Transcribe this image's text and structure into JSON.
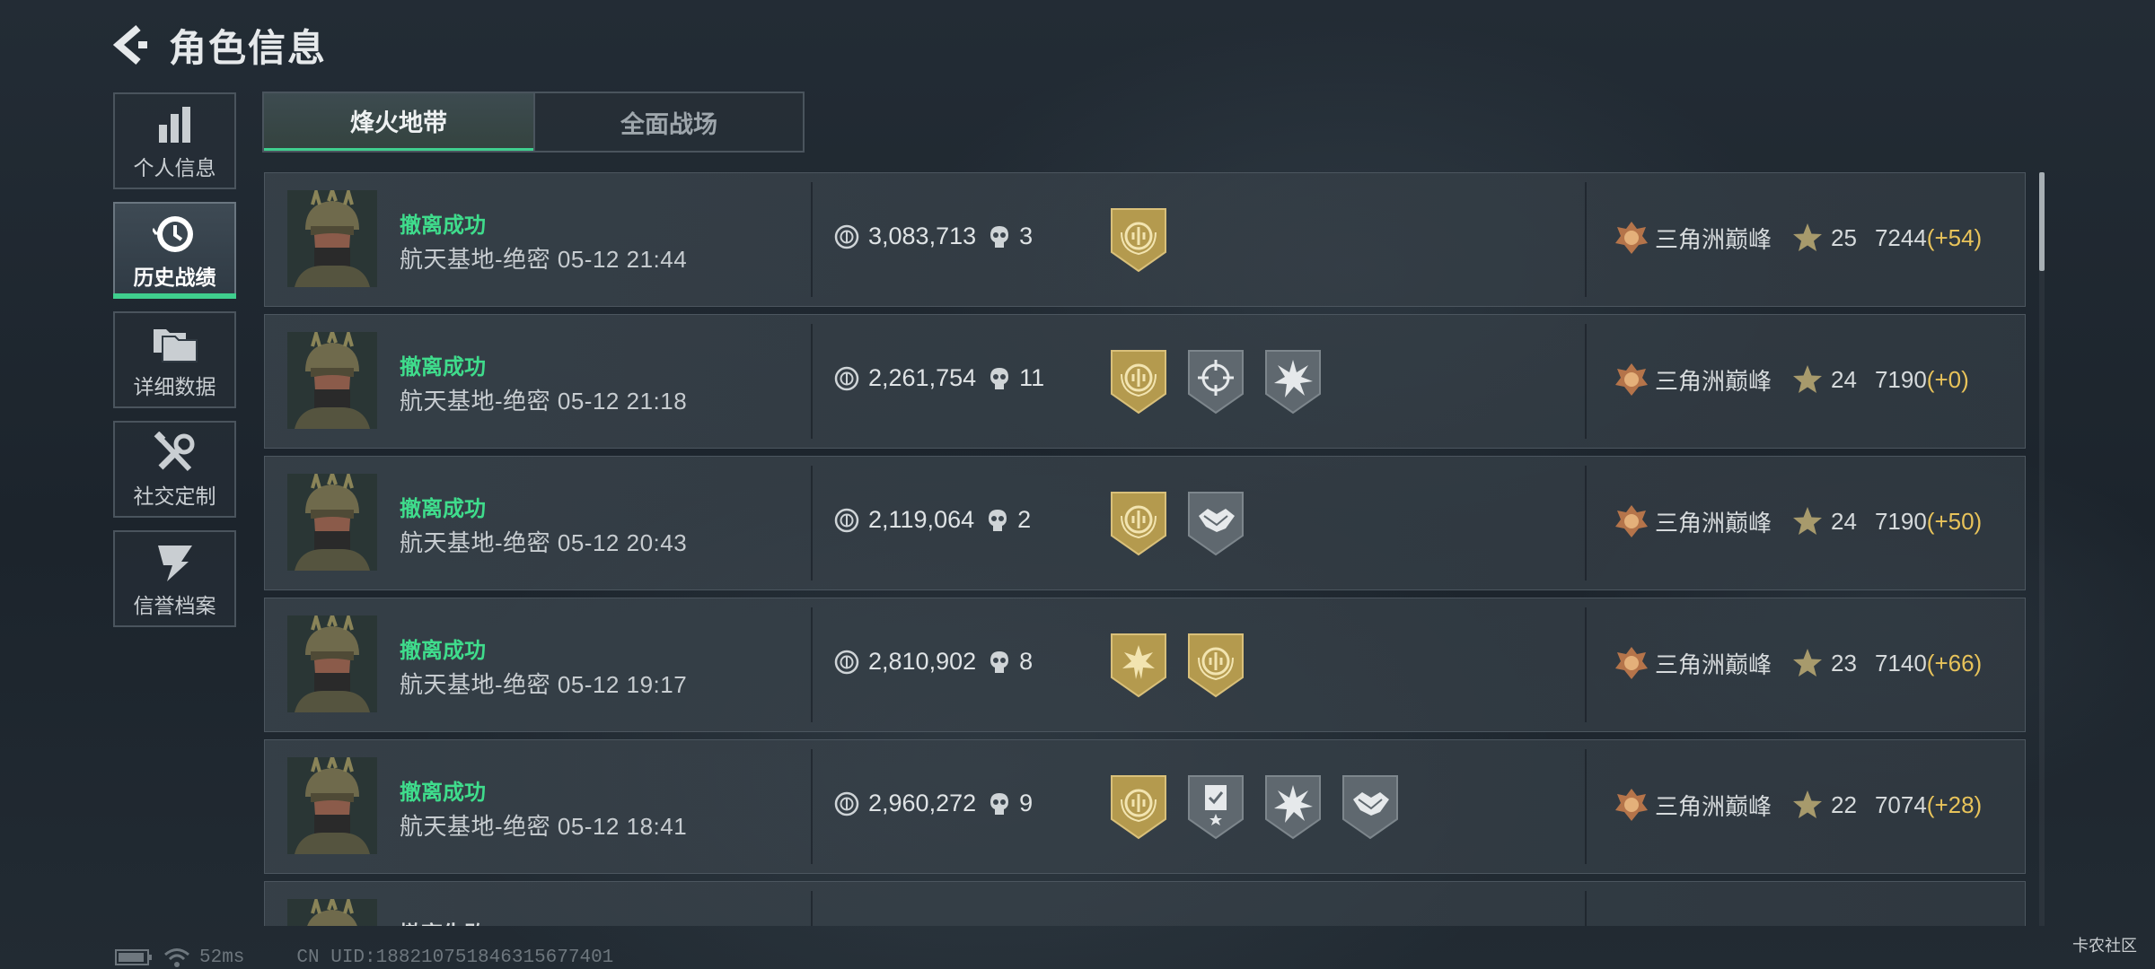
{
  "header": {
    "title": "角色信息"
  },
  "nav": [
    {
      "label": "个人信息",
      "icon": "bar-chart-icon"
    },
    {
      "label": "历史战绩",
      "icon": "history-clock-icon",
      "active": true
    },
    {
      "label": "详细数据",
      "icon": "folders-icon"
    },
    {
      "label": "社交定制",
      "icon": "tools-icon"
    },
    {
      "label": "信誉档案",
      "icon": "reputation-icon"
    }
  ],
  "tabs": [
    {
      "label": "烽火地带",
      "active": true
    },
    {
      "label": "全面战场"
    }
  ],
  "matches": [
    {
      "result": "撤离成功",
      "map_time": "航天基地-绝密 05-12 21:44",
      "value": "3,083,713",
      "kills": "3",
      "badges": [
        "gold-laurel-badge"
      ],
      "rank_name": "三角洲巅峰",
      "level": "25",
      "points": "7244",
      "delta": "(+54)"
    },
    {
      "result": "撤离成功",
      "map_time": "航天基地-绝密 05-12 21:18",
      "value": "2,261,754",
      "kills": "11",
      "badges": [
        "gold-laurel-badge",
        "grey-crosshair-badge",
        "grey-burst-badge"
      ],
      "rank_name": "三角洲巅峰",
      "level": "24",
      "points": "7190",
      "delta": "(+0)"
    },
    {
      "result": "撤离成功",
      "map_time": "航天基地-绝密 05-12 20:43",
      "value": "2,119,064",
      "kills": "2",
      "badges": [
        "gold-laurel-badge",
        "grey-handshake-badge"
      ],
      "rank_name": "三角洲巅峰",
      "level": "24",
      "points": "7190",
      "delta": "(+50)"
    },
    {
      "result": "撤离成功",
      "map_time": "航天基地-绝密 05-12 19:17",
      "value": "2,810,902",
      "kills": "8",
      "badges": [
        "gold-sun-badge",
        "gold-laurel-badge"
      ],
      "rank_name": "三角洲巅峰",
      "level": "23",
      "points": "7140",
      "delta": "(+66)"
    },
    {
      "result": "撤离成功",
      "map_time": "航天基地-绝密 05-12 18:41",
      "value": "2,960,272",
      "kills": "9",
      "badges": [
        "gold-laurel-badge",
        "grey-clipboard-badge",
        "grey-burst-badge",
        "grey-handshake-badge"
      ],
      "rank_name": "三角洲巅峰",
      "level": "22",
      "points": "7074",
      "delta": "(+28)"
    },
    {
      "result": "撤离失败",
      "map_time": "",
      "value": "",
      "kills": "",
      "badges": [],
      "rank_name": "",
      "level": "",
      "points": "",
      "delta": ""
    }
  ],
  "status": {
    "ping": "52ms",
    "uid": "CN UID:1882107518463156774​01"
  },
  "watermark": "卡农社区",
  "colors": {
    "accent_green": "#3fcf8e",
    "success_text": "#3fdc8c",
    "gold_delta": "#e8c35a",
    "badge_gold": "#b49a4e",
    "badge_grey": "#5f686f"
  }
}
